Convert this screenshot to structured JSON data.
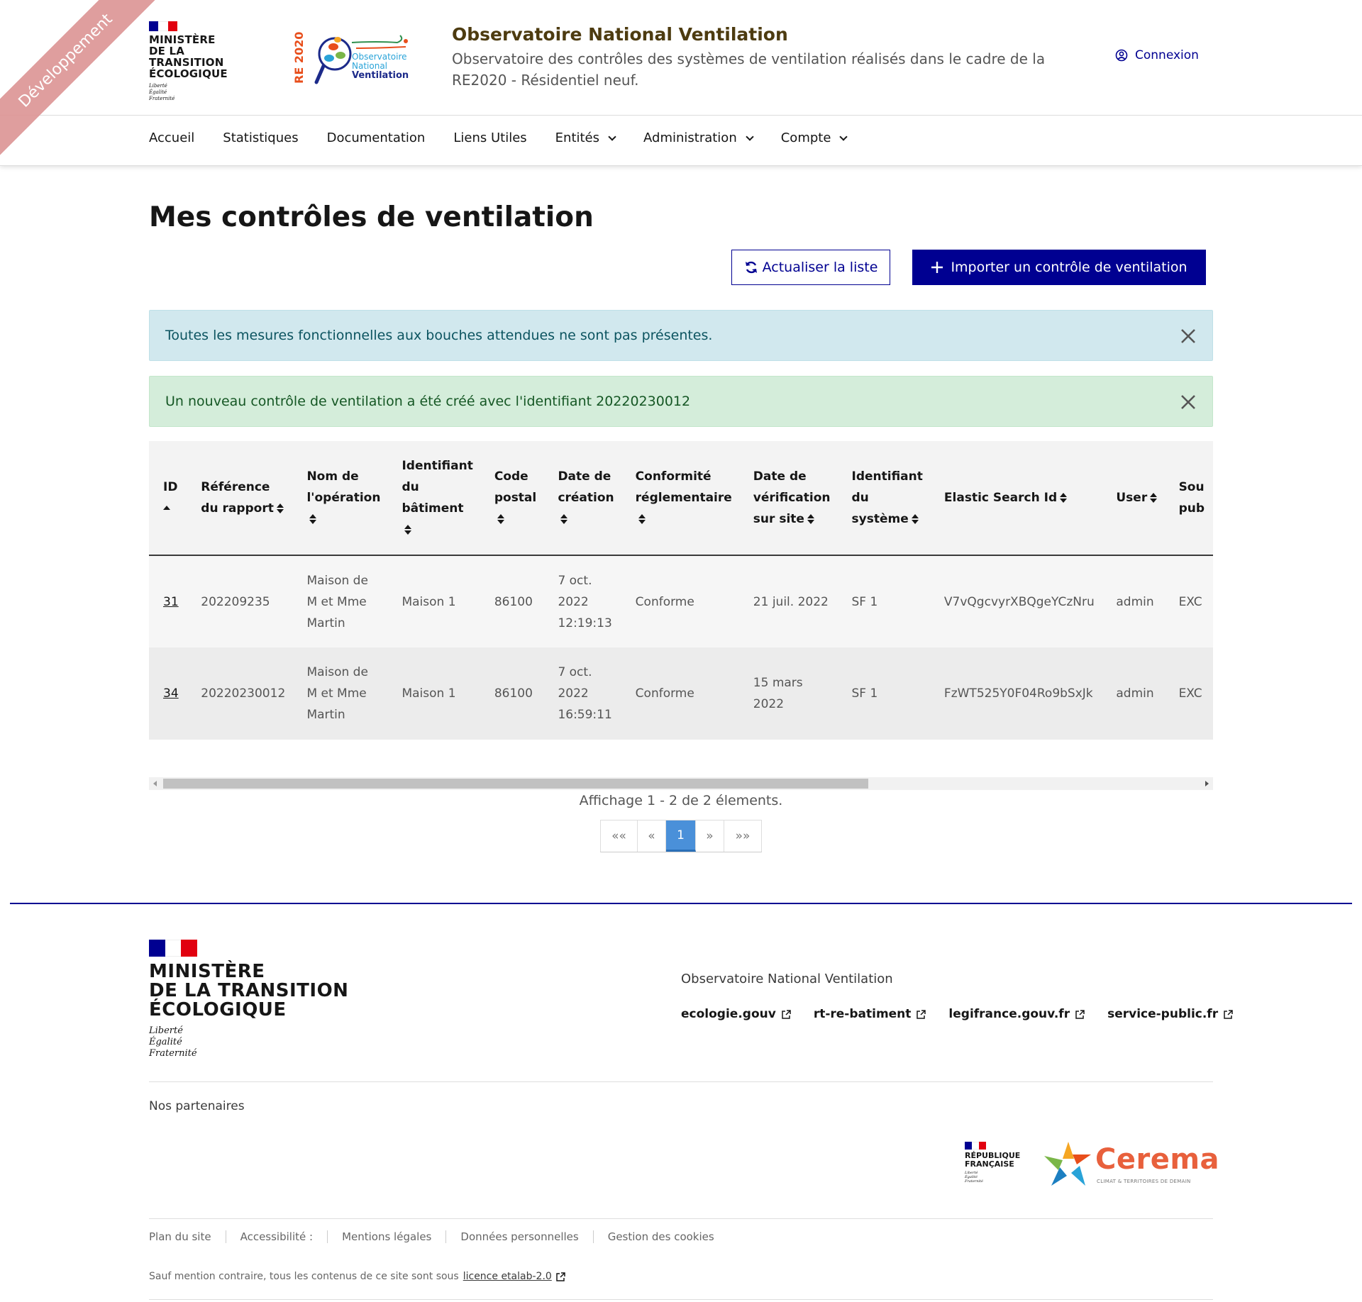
{
  "ribbon": "Développement",
  "header": {
    "ministry": [
      "MINISTÈRE",
      "DE LA TRANSITION",
      "ÉCOLOGIQUE"
    ],
    "devise": [
      "Liberté",
      "Égalité",
      "Fraternité"
    ],
    "logo_re2020": "RE 2020",
    "logo_text": [
      "Observatoire",
      "National",
      "Ventilation"
    ],
    "site_title": "Observatoire National Ventilation",
    "site_desc": "Observatoire des contrôles des systèmes de ventilation réalisés dans le cadre de la RE2020 - Résidentiel neuf.",
    "login": "Connexion"
  },
  "nav": {
    "items": [
      {
        "label": "Accueil"
      },
      {
        "label": "Statistiques"
      },
      {
        "label": "Documentation"
      },
      {
        "label": "Liens Utiles"
      },
      {
        "label": "Entités"
      },
      {
        "label": "Administration"
      },
      {
        "label": "Compte"
      }
    ]
  },
  "main": {
    "title": "Mes contrôles de ventilation",
    "refresh_label": "Actualiser la liste",
    "import_label": "Importer un contrôle de ventilation",
    "alert_info": "Toutes les mesures fonctionnelles aux bouches attendues ne sont pas présentes.",
    "alert_success": "Un nouveau contrôle de ventilation a été créé avec l'identifiant 20220230012"
  },
  "table": {
    "columns": [
      "ID",
      "Référence du rapport",
      "Nom de l'opération",
      "Identifiant du bâtiment",
      "Code postal",
      "Date de création",
      "Conformité réglementaire",
      "Date de vérification sur site",
      "Identifiant du système",
      "Elastic Search Id",
      "User",
      "Sou pub"
    ],
    "rows": [
      [
        "31",
        "202209235",
        "Maison de M et Mme Martin",
        "Maison 1",
        "86100",
        "7 oct. 2022 12:19:13",
        "Conforme",
        "21 juil. 2022",
        "SF 1",
        "V7vQgcvyrXBQgeYCzNru",
        "admin",
        "EXC"
      ],
      [
        "34",
        "20220230012",
        "Maison de M et Mme Martin",
        "Maison 1",
        "86100",
        "7 oct. 2022 16:59:11",
        "Conforme",
        "15 mars 2022",
        "SF 1",
        "FzWT525Y0F04Ro9bSxJk",
        "admin",
        "EXC"
      ]
    ],
    "summary": "Affichage 1 - 2 de 2 élements."
  },
  "pagination": {
    "first": "««",
    "prev": "«",
    "current": "1",
    "next": "»",
    "last": "»»"
  },
  "footer": {
    "ministry": [
      "MINISTÈRE",
      "DE LA TRANSITION",
      "ÉCOLOGIQUE"
    ],
    "devise": [
      "Liberté",
      "Égalité",
      "Fraternité"
    ],
    "site_name": "Observatoire National Ventilation",
    "links": [
      "ecologie.gouv",
      "rt-re-batiment",
      "legifrance.gouv.fr",
      "service-public.fr"
    ],
    "partners_label": "Nos partenaires",
    "rf": [
      "RÉPUBLIQUE",
      "FRANÇAISE"
    ],
    "cerema_name": "Cerema",
    "cerema_tag": "CLIMAT & TERRITOIRES DE DEMAIN",
    "bottom_links": [
      "Plan du site",
      "Accessibilité :",
      "Mentions légales",
      "Données personnelles",
      "Gestion des cookies"
    ],
    "licence_prefix": "Sauf mention contraire, tous les contenus de ce site sont sous",
    "licence_link": "licence etalab-2.0"
  },
  "colors": {
    "primary": "#000091",
    "site_title": "#4d3b10",
    "info_bg": "#d1e8ee",
    "success_bg": "#d4edda",
    "ribbon": "#dd9696",
    "pager_active": "#4a90d9",
    "flag_blue": "#000091",
    "flag_red": "#e1000f"
  }
}
